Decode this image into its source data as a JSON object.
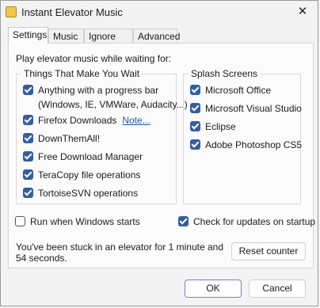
{
  "window": {
    "title": "Instant Elevator Music"
  },
  "tabs": [
    {
      "label": "Settings",
      "active": true
    },
    {
      "label": "Music"
    },
    {
      "label": "Ignore List"
    },
    {
      "label": "Advanced"
    }
  ],
  "settings": {
    "lead": "Play elevator music while waiting for:",
    "group_wait": {
      "title": "Things That Make You Wait",
      "items": [
        {
          "label": "Anything with a progress bar",
          "sub": "(Windows, IE, VMWare, Audacity...)",
          "checked": true
        },
        {
          "label": "Firefox Downloads",
          "link": "Note...",
          "checked": true
        },
        {
          "label": "DownThemAll!",
          "checked": true
        },
        {
          "label": "Free Download Manager",
          "checked": true
        },
        {
          "label": "TeraCopy file operations",
          "checked": true
        },
        {
          "label": "TortoiseSVN operations",
          "checked": true
        }
      ]
    },
    "group_splash": {
      "title": "Splash Screens",
      "items": [
        {
          "label": "Microsoft Office",
          "checked": true
        },
        {
          "label": "Microsoft Visual Studio",
          "checked": true
        },
        {
          "label": "Eclipse",
          "checked": true
        },
        {
          "label": "Adobe Photoshop CS5",
          "checked": true
        }
      ]
    },
    "run_on_start": {
      "label": "Run when Windows starts",
      "checked": false
    },
    "check_updates": {
      "label": "Check for updates on startup",
      "checked": true
    },
    "stuck_text": "You've been stuck in an elevator for 1 minute and 54 seconds.",
    "reset_button": "Reset counter"
  },
  "footer": {
    "ok": "OK",
    "cancel": "Cancel"
  },
  "colors": {
    "accent": "#2f5fa6",
    "link": "#1a59b8"
  }
}
